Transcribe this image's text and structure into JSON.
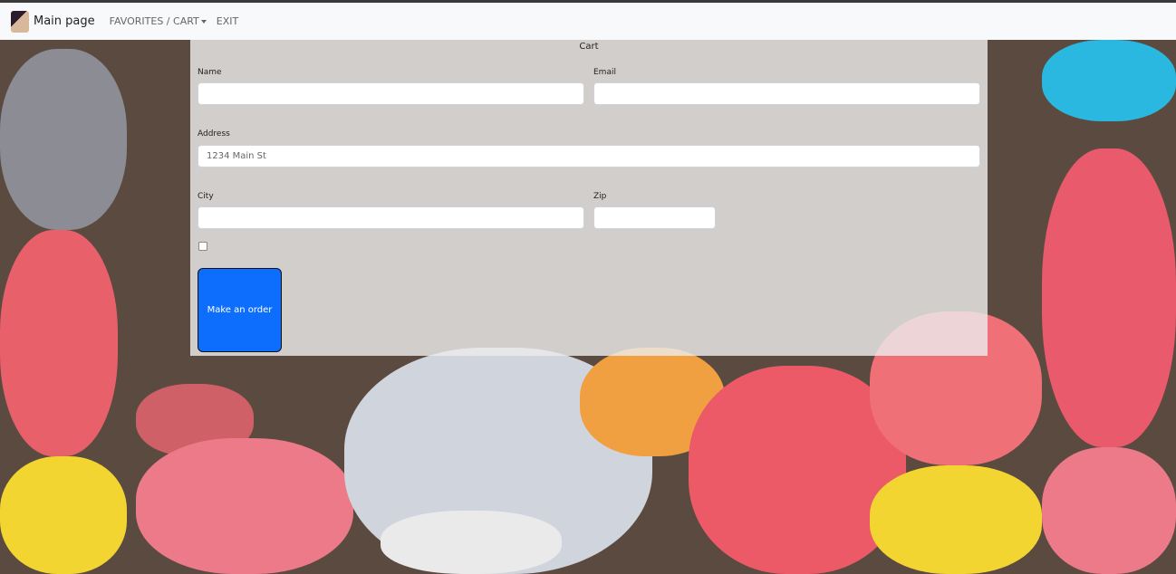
{
  "nav": {
    "brand": "Main page",
    "favorites_cart": "FAVORITES / CART",
    "exit": "EXIT"
  },
  "cart": {
    "title": "Cart",
    "name_label": "Name",
    "email_label": "Email",
    "address_label": "Address",
    "address_placeholder": "1234 Main St",
    "city_label": "City",
    "zip_label": "Zip",
    "order_button": "Make an order"
  }
}
